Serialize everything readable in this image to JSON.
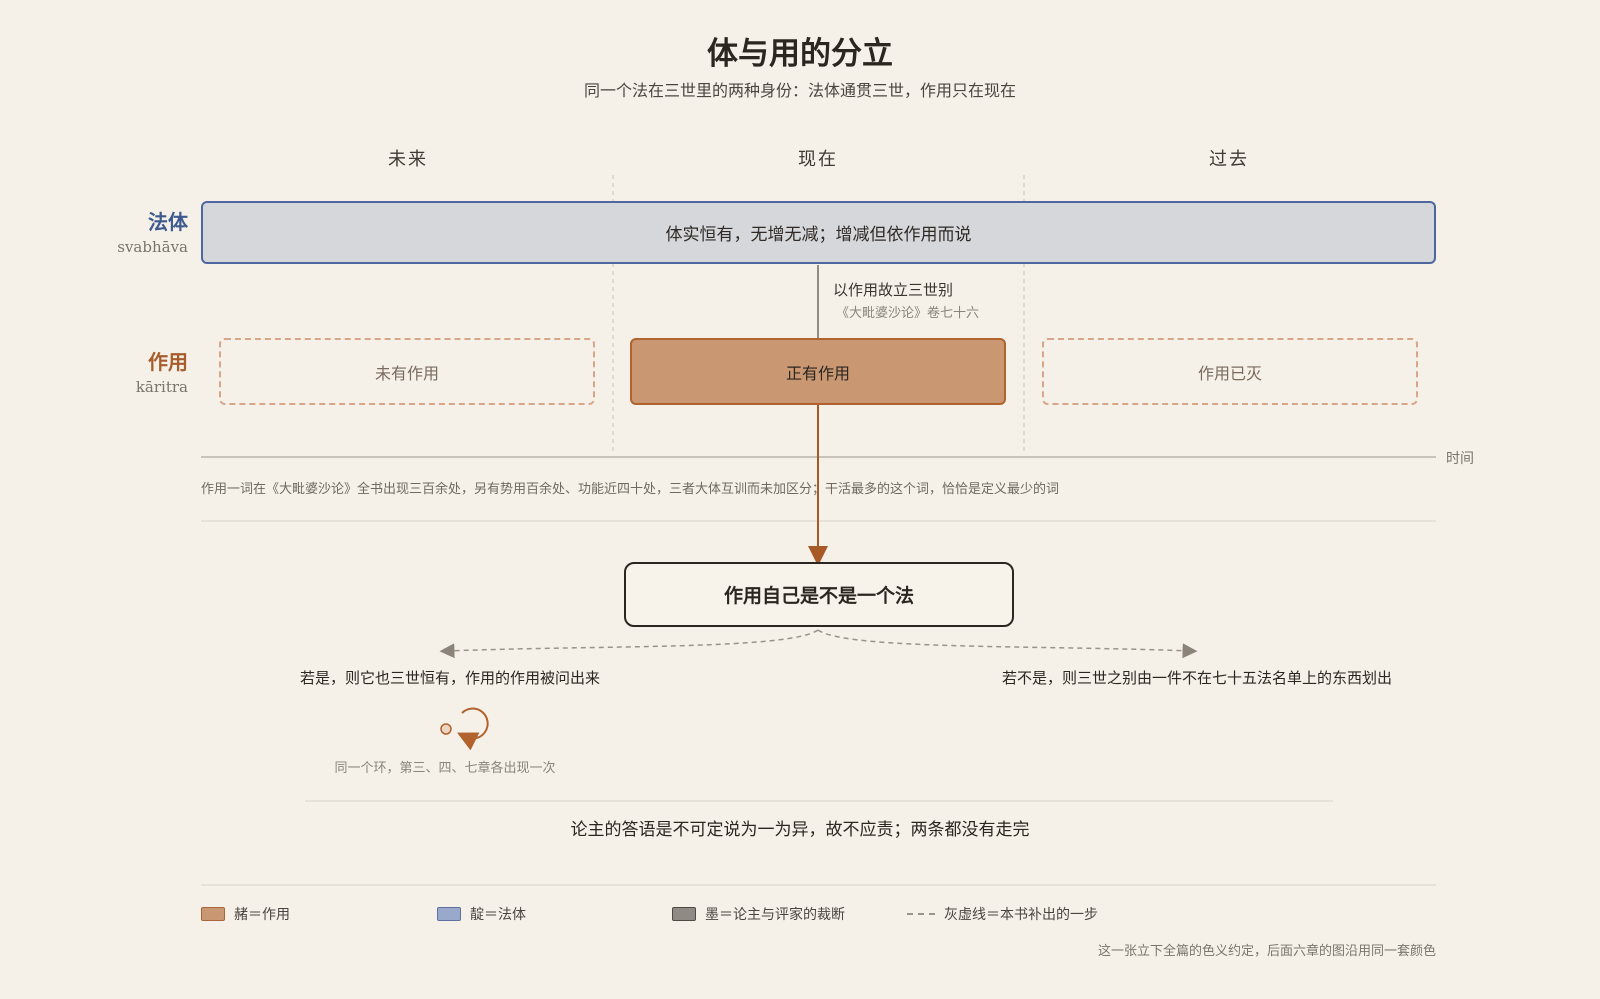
{
  "title": "体与用的分立",
  "subtitle": "同一个法在三世里的两种身份：法体通贯三世，作用只在现在",
  "periods": [
    "未来",
    "现在",
    "过去"
  ],
  "rows": {
    "svabhava": {
      "label_zh": "法体",
      "label_en": "svabhāva",
      "bar_text": "体实恒有，无增无减；增减但依作用而说"
    },
    "karitra": {
      "label_zh": "作用",
      "label_en": "kāritra",
      "boxes": [
        "未有作用",
        "正有作用",
        "作用已灭"
      ]
    }
  },
  "link_note": {
    "text": "以作用故立三世别",
    "citation": "《大毗婆沙论》卷七十六"
  },
  "time_axis_label": "时间",
  "usage_note": "作用一词在《大毗婆沙论》全书出现三百余处，另有势用百余处、功能近四十处，三者大体互训而未加区分；干活最多的这个词，恰恰是定义最少的词",
  "question": "作用自己是不是一个法",
  "branches": {
    "yes": "若是，则它也三世恒有，作用的作用被问出来",
    "no": "若不是，则三世之别由一件不在七十五法名单上的东西划出",
    "loop_note": "同一个环，第三、四、七章各出现一次"
  },
  "conclusion": "论主的答语是不可定说为一为异，故不应责；两条都没有走完",
  "legend": [
    {
      "label": "赭＝作用",
      "swatch": "ochre",
      "color": "#c99772"
    },
    {
      "label": "靛＝法体",
      "swatch": "indigo",
      "color": "#99a9cc"
    },
    {
      "label": "墨＝论主与评家的裁断",
      "swatch": "ink",
      "color": "#8f8b84"
    },
    {
      "label": "灰虚线＝本书补出的一步",
      "swatch": "dash",
      "color": "#9a938a"
    }
  ],
  "footer_note": "这一张立下全篇的色义约定，后面六章的图沿用同一套颜色",
  "colors": {
    "ochre": "#c99772",
    "ochre_line": "#b2622c",
    "indigo": "#4e67a0",
    "ink": "#2b2620",
    "background": "#f5f1e8"
  }
}
